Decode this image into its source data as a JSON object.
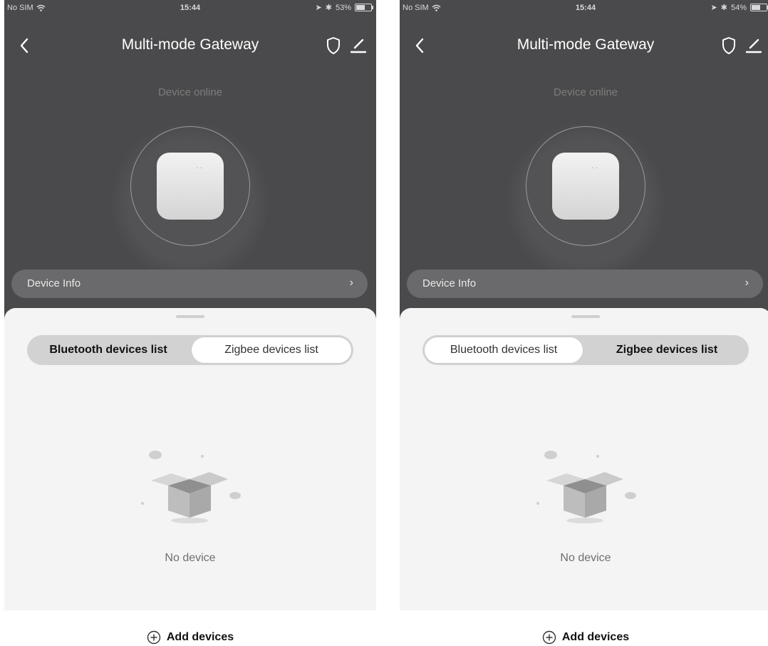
{
  "screens": [
    {
      "status": {
        "carrier": "No SIM",
        "time": "15:44",
        "battery": "53%"
      },
      "title": "Multi-mode Gateway",
      "online_text": "Device online",
      "device_info_label": "Device Info",
      "tabs": [
        {
          "label": "Bluetooth devices list",
          "selected": true
        },
        {
          "label": "Zigbee devices list",
          "selected": false
        }
      ],
      "empty_text": "No device",
      "add_label": "Add devices"
    },
    {
      "status": {
        "carrier": "No SIM",
        "time": "15:44",
        "battery": "54%"
      },
      "title": "Multi-mode Gateway",
      "online_text": "Device online",
      "device_info_label": "Device Info",
      "tabs": [
        {
          "label": "Bluetooth devices list",
          "selected": false
        },
        {
          "label": "Zigbee devices list",
          "selected": true
        }
      ],
      "empty_text": "No device",
      "add_label": "Add devices"
    }
  ],
  "colors": {
    "header_bg": "#4a4a4c",
    "sheet_bg": "#f4f4f4",
    "segment_bg": "#d2d2d2"
  },
  "icons": [
    "back-chevron-icon",
    "shield-icon",
    "edit-icon",
    "wifi-icon",
    "location-arrow-icon",
    "bluetooth-icon",
    "battery-icon",
    "chevron-right-icon",
    "empty-box-icon",
    "add-circle-icon"
  ]
}
